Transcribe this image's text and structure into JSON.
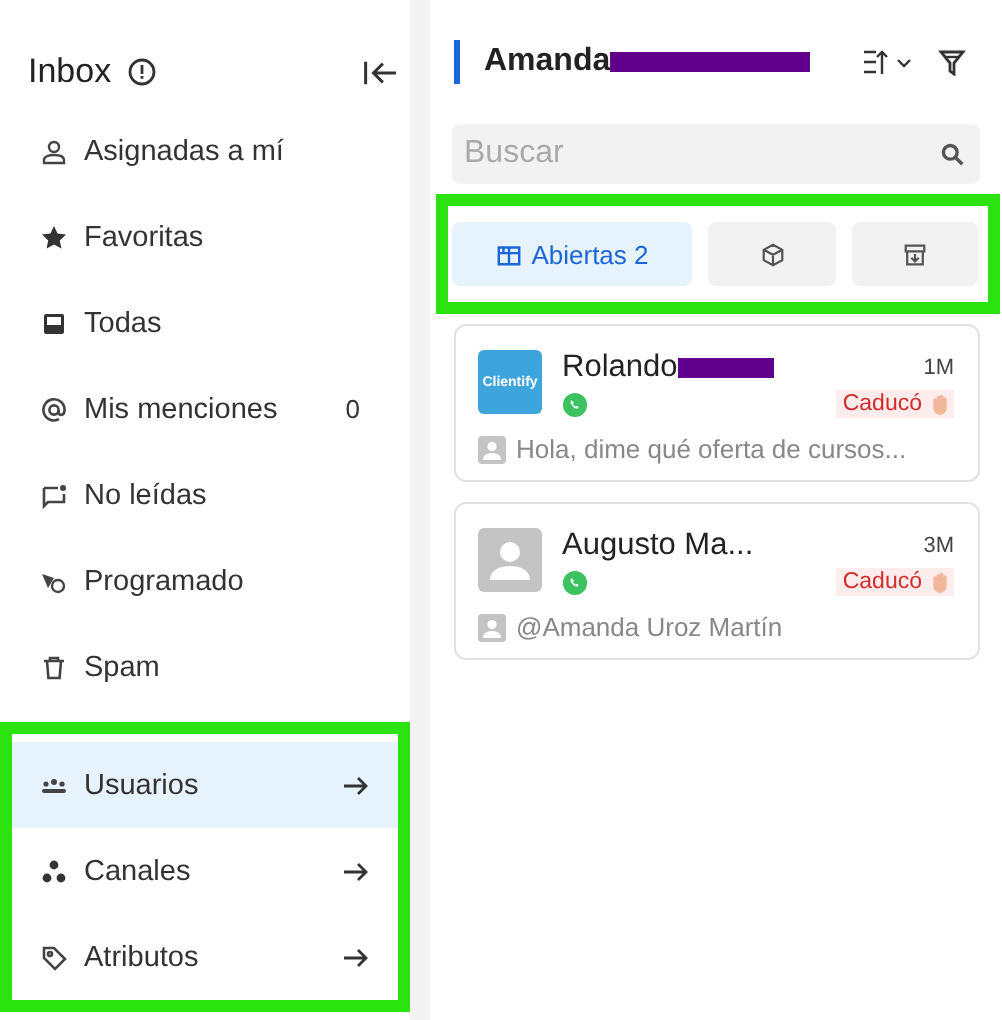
{
  "sidebar": {
    "title": "Inbox",
    "items": [
      {
        "label": "Asignadas a mí",
        "selected": false
      },
      {
        "label": "Favoritas",
        "selected": false
      },
      {
        "label": "Todas",
        "selected": false
      },
      {
        "label": "Mis menciones",
        "count": "0",
        "selected": false
      },
      {
        "label": "No leídas",
        "selected": false
      },
      {
        "label": "Programado",
        "selected": false
      },
      {
        "label": "Spam",
        "selected": false
      }
    ],
    "settings": [
      {
        "label": "Usuarios",
        "selected": true
      },
      {
        "label": "Canales",
        "selected": false
      },
      {
        "label": "Atributos",
        "selected": false
      }
    ]
  },
  "header": {
    "name": "Amanda",
    "redacted": true
  },
  "search": {
    "placeholder": "Buscar"
  },
  "tabs": [
    {
      "kind": "open",
      "label": "Abiertas 2",
      "selected": true
    },
    {
      "kind": "box",
      "selected": false
    },
    {
      "kind": "archive",
      "selected": false
    }
  ],
  "conversations": [
    {
      "kind": "logo",
      "logo_text": "Clientify",
      "name": "Rolando",
      "redacted": true,
      "time": "1M",
      "status": "Caducó",
      "preview": "Hola, dime qué oferta de cursos..."
    },
    {
      "kind": "person",
      "name": "Augusto Ma...",
      "redacted": false,
      "time": "3M",
      "status": "Caducó",
      "preview": "@Amanda Uroz Martín"
    }
  ]
}
